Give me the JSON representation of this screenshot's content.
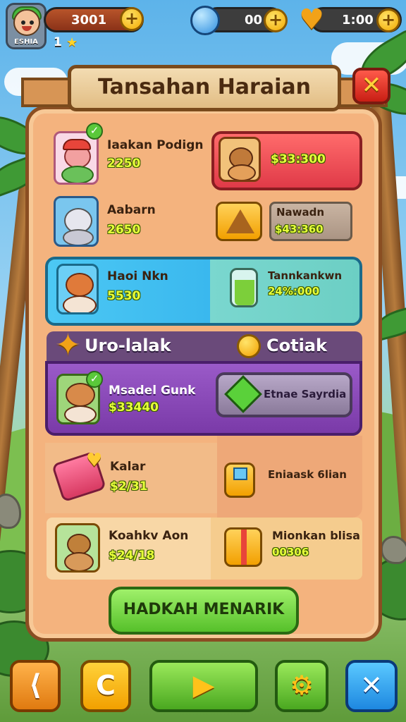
{
  "top_bar": {
    "avatar_name": "ESHIA",
    "coins": "3001",
    "level": "1",
    "gems": "00",
    "hearts": "1:00",
    "plus_label": "+"
  },
  "panel": {
    "title": "Tansahan Haraian",
    "close_label": "✕"
  },
  "shop_items": [
    {
      "name": "Iaakan Podign",
      "price": "2250"
    },
    {
      "name": "",
      "price": "$33:300"
    },
    {
      "name": "Aabarn",
      "price": "2650"
    },
    {
      "name": "Nawadn",
      "price": "$43:360"
    },
    {
      "name": "Haoi Nkn",
      "price": "5530"
    },
    {
      "name": "Tannkankwn",
      "price": "24%:000"
    }
  ],
  "section": {
    "left_label": "Uro-lalak",
    "right_label": "Cotiak"
  },
  "featured": {
    "name": "Msadel Gunk",
    "price": "$33440",
    "button_label": "Etnae Sayrdia"
  },
  "lower_items": [
    {
      "name": "Kalar",
      "price": "$2/31"
    },
    {
      "name": "Eniaask 6lian",
      "price": ""
    },
    {
      "name": "Koahkv Aon",
      "price": "$24/18"
    },
    {
      "name": "Mionkan blisa",
      "price": "00306"
    }
  ],
  "claim_button": "HADKAH MENARIK",
  "bottom_nav": {
    "back_glyph": "⟨",
    "c_glyph": "C",
    "play_glyph": "▶",
    "settings_glyph": "⚙",
    "close_glyph": "✕"
  },
  "colors": {
    "panel": "#f4b37e",
    "red_row": "#e03a48",
    "cyan_row": "#3ab8ee",
    "purple_row": "#7a3aa8",
    "claim_button": "#56c02a",
    "price_text": "#e7ff3a"
  }
}
